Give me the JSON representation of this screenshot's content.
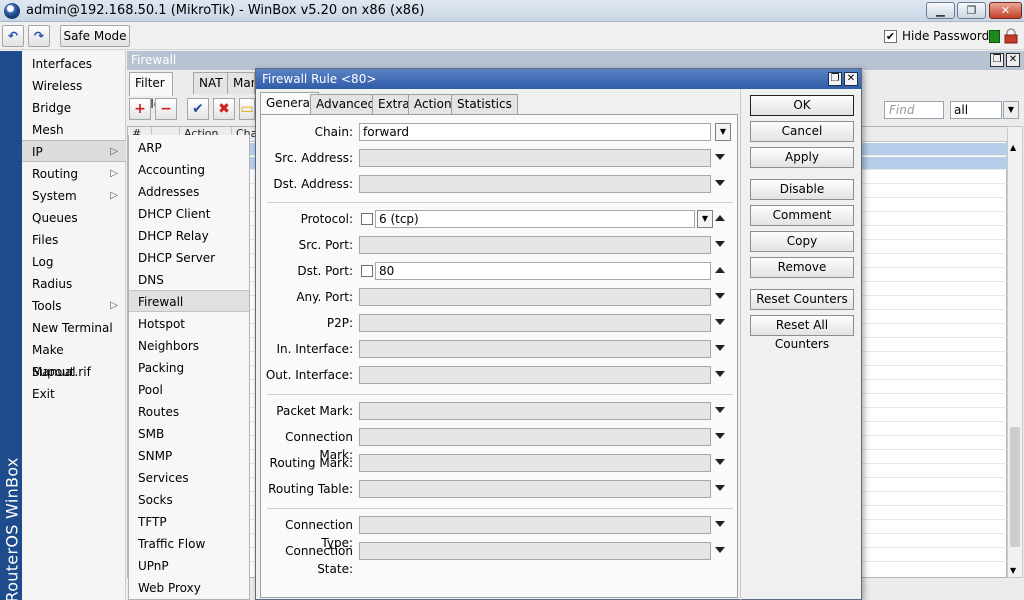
{
  "window": {
    "title": "admin@192.168.50.1 (MikroTik) - WinBox v5.20 on x86 (x86)"
  },
  "toolbar": {
    "safe_mode": "Safe Mode",
    "hide_passwords": "Hide Passwords"
  },
  "brand": "RouterOS WinBox",
  "mainmenu": [
    "Interfaces",
    "Wireless",
    "Bridge",
    "Mesh",
    "IP",
    "Routing",
    "System",
    "Queues",
    "Files",
    "Log",
    "Radius",
    "Tools",
    "New Terminal",
    "Make Supout.rif",
    "Manual",
    "Exit"
  ],
  "submenu": [
    "ARP",
    "Accounting",
    "Addresses",
    "DHCP Client",
    "DHCP Relay",
    "DHCP Server",
    "DNS",
    "Firewall",
    "Hotspot",
    "Neighbors",
    "Packing",
    "Pool",
    "Routes",
    "SMB",
    "SNMP",
    "Services",
    "Socks",
    "TFTP",
    "Traffic Flow",
    "UPnP",
    "Web Proxy"
  ],
  "firewall": {
    "title": "Firewall",
    "tabs": [
      "Filter Rules",
      "NAT",
      "Mang"
    ],
    "find_placeholder": "Find",
    "filter_value": "all",
    "columns": [
      "#",
      "Action",
      "Chain"
    ]
  },
  "dialog": {
    "title": "Firewall Rule <80>",
    "tabs": [
      "General",
      "Advanced",
      "Extra",
      "Action",
      "Statistics"
    ],
    "fields": {
      "chain": {
        "label": "Chain:",
        "value": "forward"
      },
      "src_address": {
        "label": "Src. Address:"
      },
      "dst_address": {
        "label": "Dst. Address:"
      },
      "protocol": {
        "label": "Protocol:",
        "value": "6 (tcp)"
      },
      "src_port": {
        "label": "Src. Port:"
      },
      "dst_port": {
        "label": "Dst. Port:",
        "value": "80"
      },
      "any_port": {
        "label": "Any. Port:"
      },
      "p2p": {
        "label": "P2P:"
      },
      "in_interface": {
        "label": "In. Interface:"
      },
      "out_interface": {
        "label": "Out. Interface:"
      },
      "packet_mark": {
        "label": "Packet Mark:"
      },
      "connection_mark": {
        "label": "Connection Mark:"
      },
      "routing_mark": {
        "label": "Routing Mark:"
      },
      "routing_table": {
        "label": "Routing Table:"
      },
      "connection_type": {
        "label": "Connection Type:"
      },
      "connection_state": {
        "label": "Connection State:"
      }
    },
    "buttons": {
      "ok": "OK",
      "cancel": "Cancel",
      "apply": "Apply",
      "disable": "Disable",
      "comment": "Comment",
      "copy": "Copy",
      "remove": "Remove",
      "reset_counters": "Reset Counters",
      "reset_all_counters": "Reset All Counters"
    }
  }
}
